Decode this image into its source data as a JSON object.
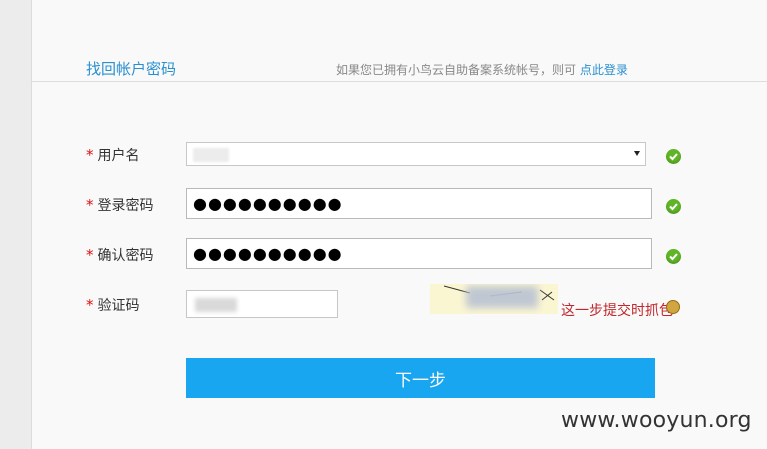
{
  "header": {
    "title": "找回帐户密码",
    "hint_text": "如果您已拥有小鸟云自助备案系统帐号，则可",
    "login_link": "点此登录"
  },
  "form": {
    "username_label": "用户名",
    "password_label": "登录密码",
    "confirm_label": "确认密码",
    "captcha_label": "验证码",
    "password_mask": "●●●●●●●●●●",
    "confirm_mask": "●●●●●●●●●●",
    "required_mark": "*",
    "captcha_note": "这一步提交时抓包"
  },
  "submit_label": "下一步",
  "watermark": "www.wooyun.org"
}
